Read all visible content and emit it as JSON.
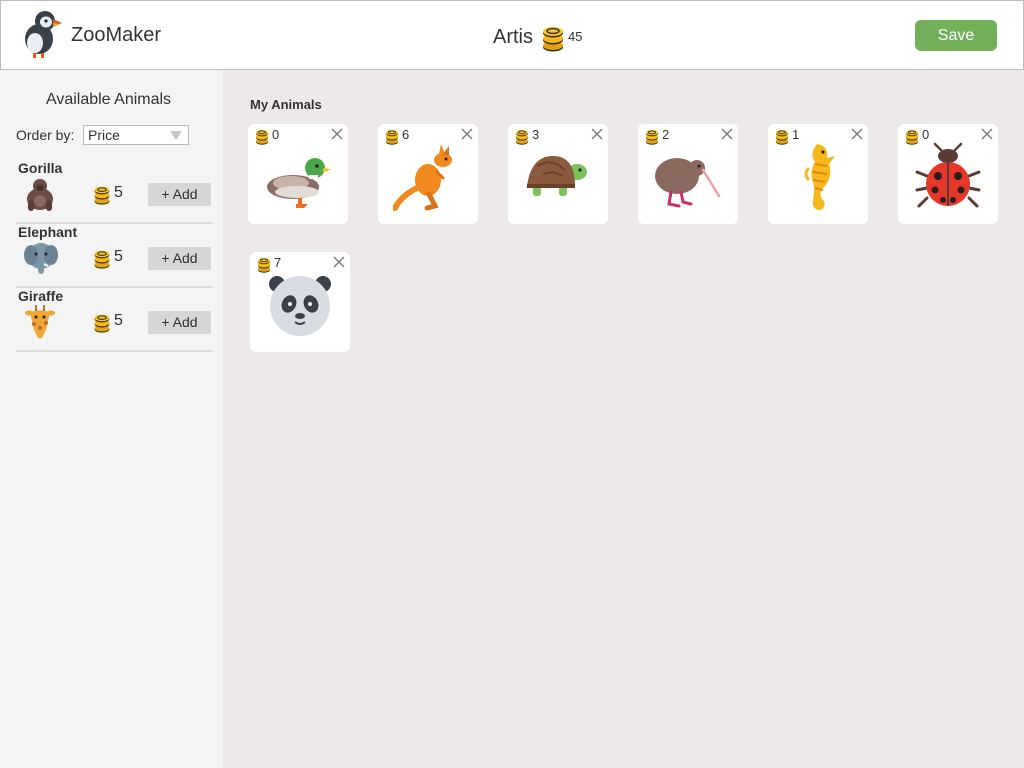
{
  "header": {
    "app_title": "ZooMaker",
    "zoo_name": "Artis",
    "coins": "45",
    "save_label": "Save"
  },
  "sidebar": {
    "title": "Available Animals",
    "order_label": "Order by:",
    "order_value": "Price",
    "items": [
      {
        "name": "Gorilla",
        "price": "5",
        "add_label": "+ Add",
        "icon": "gorilla-icon"
      },
      {
        "name": "Elephant",
        "price": "5",
        "add_label": "+ Add",
        "icon": "elephant-icon"
      },
      {
        "name": "Giraffe",
        "price": "5",
        "add_label": "+ Add",
        "icon": "giraffe-icon"
      }
    ]
  },
  "main": {
    "title": "My Animals",
    "cards": [
      {
        "animal": "duck-icon",
        "count": "0"
      },
      {
        "animal": "kangaroo-icon",
        "count": "6"
      },
      {
        "animal": "turtle-icon",
        "count": "3"
      },
      {
        "animal": "kiwi-icon",
        "count": "2"
      },
      {
        "animal": "seahorse-icon",
        "count": "1"
      },
      {
        "animal": "ladybug-icon",
        "count": "0"
      },
      {
        "animal": "panda-icon",
        "count": "7"
      }
    ]
  },
  "colors": {
    "save_button": "#72b05a",
    "main_background": "#ece9e8",
    "sidebar_background": "#f4f4f4"
  }
}
